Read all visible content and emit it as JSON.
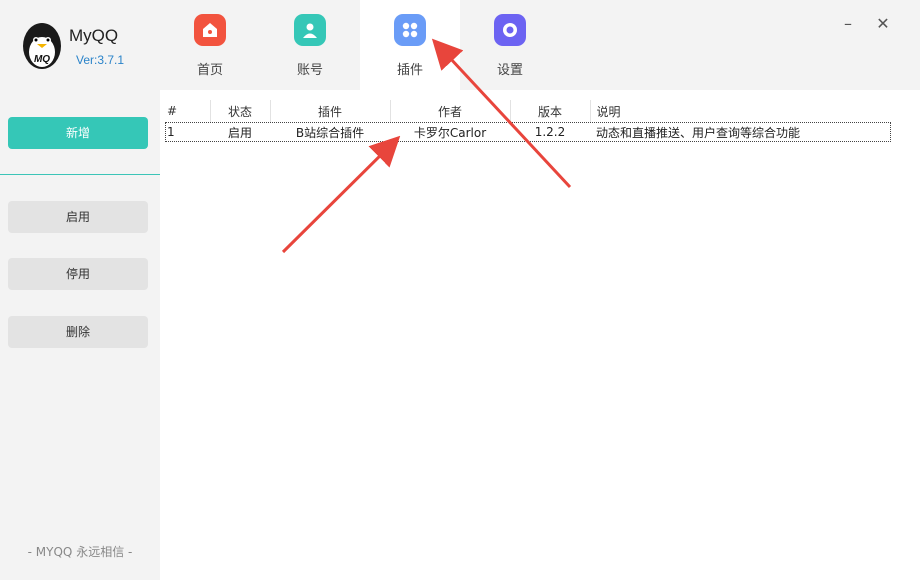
{
  "app": {
    "name": "MyQQ",
    "version": "Ver:3.7.1",
    "logo_text": "MQ"
  },
  "tabs": [
    {
      "label": "首页",
      "icon": "home-icon",
      "color": "#f2533e"
    },
    {
      "label": "账号",
      "icon": "user-icon",
      "color": "#35c7b7"
    },
    {
      "label": "插件",
      "icon": "plugin-grid-icon",
      "color": "#6a9cf7"
    },
    {
      "label": "设置",
      "icon": "settings-icon",
      "color": "#6c63f2"
    }
  ],
  "active_tab": "插件",
  "window": {
    "minimize": "–",
    "close": "✕"
  },
  "sidebar": {
    "add_label": "新增",
    "enable_label": "启用",
    "disable_label": "停用",
    "delete_label": "删除",
    "footer": "- MYQQ 永远相信 -"
  },
  "table": {
    "headers": [
      "#",
      "状态",
      "插件",
      "作者",
      "版本",
      "说明"
    ],
    "rows": [
      [
        "1",
        "启用",
        "B站综合插件",
        "卡罗尔Carlor",
        "1.2.2",
        "动态和直播推送、用户查询等综合功能"
      ]
    ]
  },
  "colors": {
    "accent": "#35c7b7",
    "annotation_arrow": "#e8453c"
  }
}
